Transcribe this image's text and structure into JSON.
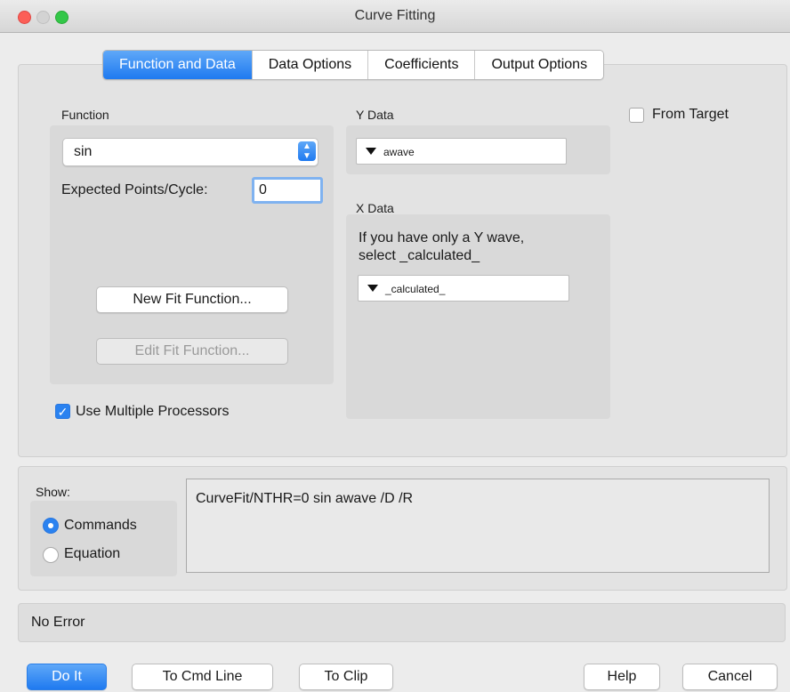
{
  "window": {
    "title": "Curve Fitting"
  },
  "tabs": [
    {
      "label": "Function and Data",
      "active": true
    },
    {
      "label": "Data Options",
      "active": false
    },
    {
      "label": "Coefficients",
      "active": false
    },
    {
      "label": "Output Options",
      "active": false
    }
  ],
  "function": {
    "group_label": "Function",
    "selected": "sin",
    "expected_label": "Expected Points/Cycle:",
    "expected_value": "0",
    "new_fit_label": "New Fit Function...",
    "edit_fit_label": "Edit Fit Function..."
  },
  "ydata": {
    "label": "Y Data",
    "value": "awave"
  },
  "from_target": {
    "label": "From Target",
    "checked": false
  },
  "xdata": {
    "label": "X Data",
    "hint_line1": "If you have only a Y wave,",
    "hint_line2": "select _calculated_",
    "value": "_calculated_"
  },
  "use_multiple": {
    "label": "Use Multiple Processors",
    "checked": true
  },
  "show": {
    "label": "Show:",
    "options": [
      {
        "label": "Commands",
        "selected": true
      },
      {
        "label": "Equation",
        "selected": false
      }
    ]
  },
  "command_text": "CurveFit/NTHR=0 sin awave /D /R",
  "status": "No Error",
  "buttons": {
    "do_it": "Do It",
    "to_cmd_line": "To Cmd Line",
    "to_clip": "To Clip",
    "help": "Help",
    "cancel": "Cancel"
  },
  "colors": {
    "accent": "#1f7af0",
    "background": "#ececec"
  }
}
